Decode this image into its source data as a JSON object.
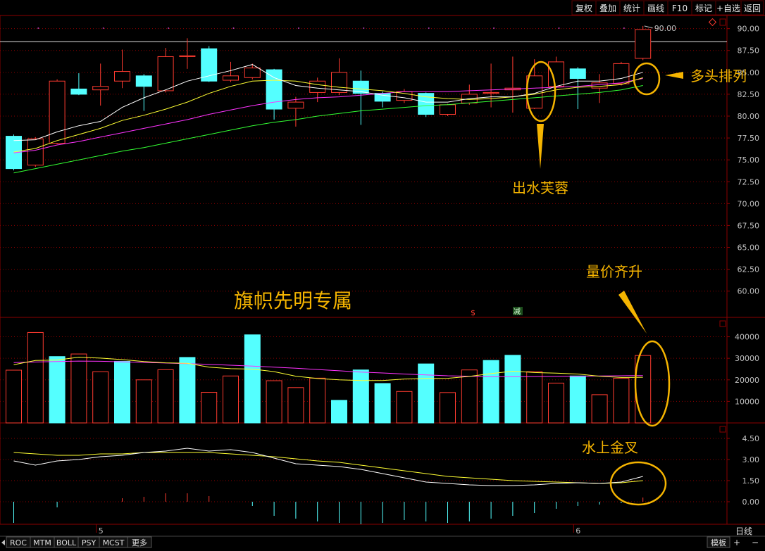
{
  "toolbar": {
    "buttons": [
      "复权",
      "叠加",
      "统计",
      "画线",
      "F10",
      "标记",
      "+自选",
      "返回"
    ]
  },
  "bottom_tabs": [
    "ROC",
    "MTM",
    "BOLL",
    "PSY",
    "MCST",
    "更多"
  ],
  "bottom_right": {
    "tab": "模板",
    "plus": "+",
    "minus": "−"
  },
  "period_label": "日线",
  "month_labels": [
    {
      "text": "5",
      "at": 4
    },
    {
      "text": "6",
      "at": 26
    }
  ],
  "event_marks": {
    "s": "$",
    "jian": "减"
  },
  "watermark": "旗帜先明专属",
  "annotations": {
    "a1": "出水芙蓉",
    "a2": "多头排列",
    "a3": "量价齐升",
    "a4": "水上金叉"
  },
  "colors": {
    "up": "#ff3b30",
    "down": "#54ffff",
    "grid_red": "#8b0000",
    "ma_white": "#ffffff",
    "ma_yellow": "#ffff33",
    "ma_magenta": "#ff33ff",
    "ma_green": "#33ff33",
    "annotation": "#f5b400",
    "axis_text": "#c0c0c0"
  },
  "chart_data": [
    {
      "type": "candlestick",
      "panel": "price",
      "yticks": [
        90.0,
        87.5,
        85.0,
        82.5,
        80.0,
        77.5,
        75.0,
        72.5,
        70.0,
        67.5,
        65.0,
        62.5,
        60.0
      ],
      "ylim": [
        57.0,
        91.5
      ],
      "hline": 88.5,
      "price_label": "90.00",
      "candles": [
        {
          "o": 77.7,
          "c": 74.0,
          "h": 77.9,
          "l": 73.8
        },
        {
          "o": 74.4,
          "c": 77.4,
          "h": 77.6,
          "l": 74.2
        },
        {
          "o": 76.9,
          "c": 84.0,
          "h": 84.2,
          "l": 76.8
        },
        {
          "o": 83.1,
          "c": 82.5,
          "h": 84.9,
          "l": 82.4
        },
        {
          "o": 83.0,
          "c": 83.4,
          "h": 86.0,
          "l": 81.2
        },
        {
          "o": 84.0,
          "c": 85.1,
          "h": 87.6,
          "l": 83.2
        },
        {
          "o": 84.6,
          "c": 83.4,
          "h": 84.8,
          "l": 80.6
        },
        {
          "o": 82.9,
          "c": 86.8,
          "h": 87.8,
          "l": 82.7
        },
        {
          "o": 86.8,
          "c": 86.9,
          "h": 88.9,
          "l": 85.4
        },
        {
          "o": 87.7,
          "c": 84.0,
          "h": 88.0,
          "l": 83.9
        },
        {
          "o": 84.1,
          "c": 84.6,
          "h": 86.2,
          "l": 83.9
        },
        {
          "o": 84.4,
          "c": 85.5,
          "h": 86.0,
          "l": 84.2
        },
        {
          "o": 85.3,
          "c": 80.8,
          "h": 85.4,
          "l": 79.6
        },
        {
          "o": 80.9,
          "c": 81.6,
          "h": 82.2,
          "l": 78.8
        },
        {
          "o": 82.7,
          "c": 84.0,
          "h": 84.4,
          "l": 81.6
        },
        {
          "o": 82.7,
          "c": 85.0,
          "h": 86.6,
          "l": 82.4
        },
        {
          "o": 84.0,
          "c": 82.6,
          "h": 85.2,
          "l": 79.0
        },
        {
          "o": 82.6,
          "c": 81.7,
          "h": 82.8,
          "l": 81.0
        },
        {
          "o": 81.8,
          "c": 82.8,
          "h": 83.1,
          "l": 81.5
        },
        {
          "o": 82.6,
          "c": 80.2,
          "h": 82.7,
          "l": 79.9
        },
        {
          "o": 80.2,
          "c": 81.3,
          "h": 81.4,
          "l": 80.0
        },
        {
          "o": 81.5,
          "c": 82.5,
          "h": 83.6,
          "l": 81.3
        },
        {
          "o": 82.6,
          "c": 82.7,
          "h": 86.0,
          "l": 81.0
        },
        {
          "o": 83.0,
          "c": 83.2,
          "h": 86.8,
          "l": 80.4
        },
        {
          "o": 80.9,
          "c": 84.6,
          "h": 86.5,
          "l": 80.8
        },
        {
          "o": 83.4,
          "c": 86.2,
          "h": 86.8,
          "l": 83.2
        },
        {
          "o": 85.4,
          "c": 84.3,
          "h": 85.6,
          "l": 80.8
        },
        {
          "o": 83.2,
          "c": 83.8,
          "h": 84.8,
          "l": 81.5
        },
        {
          "o": 83.7,
          "c": 86.0,
          "h": 86.2,
          "l": 83.5
        },
        {
          "o": 86.6,
          "c": 89.9,
          "h": 90.3,
          "l": 86.4
        }
      ],
      "ma_white": [
        77.2,
        77.3,
        78.2,
        78.9,
        79.4,
        81.0,
        82.1,
        83.0,
        84.0,
        84.6,
        85.2,
        85.9,
        84.4,
        83.5,
        83.2,
        83.0,
        82.8,
        82.4,
        82.1,
        81.6,
        81.6,
        82.0,
        82.2,
        82.2,
        82.6,
        83.4,
        84.0,
        84.0,
        84.3,
        85.0
      ],
      "ma_yellow": [
        75.9,
        76.3,
        77.2,
        77.9,
        78.6,
        79.5,
        80.1,
        80.8,
        81.6,
        82.6,
        83.4,
        84.0,
        84.1,
        84.0,
        83.6,
        83.3,
        83.1,
        82.9,
        82.6,
        82.2,
        82.0,
        81.9,
        82.0,
        82.2,
        82.5,
        83.0,
        83.3,
        83.4,
        83.6,
        84.4
      ],
      "ma_magenta": [
        75.8,
        76.1,
        76.7,
        77.1,
        77.6,
        78.1,
        78.6,
        79.1,
        79.6,
        80.2,
        80.7,
        81.2,
        81.6,
        81.9,
        82.1,
        82.2,
        82.4,
        82.6,
        82.8,
        82.8,
        82.8,
        82.9,
        83.0,
        83.1,
        83.2,
        83.3,
        83.4,
        83.6,
        83.8,
        84.3
      ],
      "ma_green": [
        73.5,
        74.0,
        74.5,
        75.0,
        75.5,
        76.0,
        76.4,
        76.9,
        77.4,
        77.9,
        78.4,
        78.9,
        79.3,
        79.6,
        80.0,
        80.3,
        80.6,
        80.8,
        81.0,
        81.2,
        81.3,
        81.5,
        81.7,
        81.9,
        82.1,
        82.3,
        82.5,
        82.7,
        83.0,
        83.5
      ]
    },
    {
      "type": "bar",
      "panel": "volume",
      "yticks": [
        40000,
        30000,
        20000,
        10000
      ],
      "ylim": [
        0,
        49000
      ],
      "values": [
        24500,
        42000,
        30800,
        32000,
        23800,
        28600,
        20000,
        24700,
        30400,
        14200,
        21800,
        40900,
        19600,
        16400,
        20800,
        10500,
        24600,
        18300,
        14600,
        27400,
        14100,
        24600,
        29000,
        31400,
        23800,
        18500,
        21800,
        13100,
        20700,
        31300
      ],
      "up_flags": [
        1,
        1,
        0,
        1,
        1,
        0,
        1,
        1,
        0,
        1,
        1,
        0,
        1,
        1,
        1,
        0,
        0,
        0,
        1,
        0,
        1,
        1,
        0,
        0,
        1,
        1,
        0,
        1,
        1,
        1
      ],
      "ma_white": [
        27000,
        29000,
        29200,
        30500,
        30100,
        29400,
        28500,
        27900,
        27700,
        25900,
        25200,
        25000,
        23800,
        21700,
        20600,
        20000,
        19700,
        19700,
        20400,
        20600,
        20700,
        21600,
        22900,
        24000,
        23400,
        23100,
        22700,
        21700,
        21100,
        21200
      ],
      "ma_magenta": [
        28000,
        28300,
        28500,
        28700,
        28600,
        28400,
        28100,
        27800,
        27500,
        27200,
        26800,
        26400,
        25900,
        25400,
        24800,
        24200,
        23600,
        23200,
        22700,
        22300,
        21900,
        21700,
        21400,
        21500,
        21500,
        21600,
        21700,
        21800,
        21900,
        22000
      ]
    },
    {
      "type": "line",
      "panel": "indicator",
      "yticks": [
        4.5,
        3.0,
        1.5,
        0.0
      ],
      "ylim": [
        -1.6,
        5.6
      ],
      "line_white": [
        2.9,
        2.6,
        2.9,
        3.0,
        3.2,
        3.3,
        3.5,
        3.6,
        3.8,
        3.6,
        3.7,
        3.5,
        3.1,
        2.7,
        2.6,
        2.5,
        2.3,
        2.0,
        1.7,
        1.4,
        1.3,
        1.2,
        1.15,
        1.15,
        1.2,
        1.3,
        1.35,
        1.3,
        1.4,
        1.8
      ],
      "line_yellow": [
        3.5,
        3.4,
        3.3,
        3.3,
        3.4,
        3.4,
        3.5,
        3.5,
        3.5,
        3.5,
        3.4,
        3.3,
        3.2,
        3.05,
        2.9,
        2.8,
        2.6,
        2.4,
        2.2,
        2.0,
        1.8,
        1.7,
        1.6,
        1.5,
        1.45,
        1.4,
        1.35,
        1.3,
        1.35,
        1.5
      ],
      "hist": [
        -1.5,
        0,
        -0.4,
        0,
        0,
        0.25,
        0.35,
        0.6,
        0.6,
        0.4,
        0,
        -0.3,
        -1.0,
        -1.2,
        -1.4,
        -1.5,
        -1.6,
        -1.5,
        -1.3,
        -1.4,
        -1.5,
        -1.4,
        -1.2,
        -1.0,
        -0.8,
        -0.5,
        -0.3,
        -0.2,
        -0.1,
        0.3
      ]
    }
  ]
}
